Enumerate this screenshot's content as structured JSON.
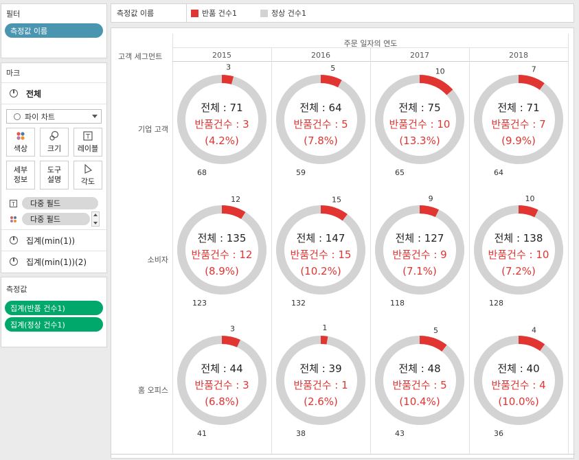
{
  "filters": {
    "title": "필터",
    "pill": "측정값 이름"
  },
  "marks": {
    "title": "마크",
    "all_label": "전체",
    "mark_type": "파이 차트",
    "buttons": [
      "색상",
      "크기",
      "레이블",
      "세부\n정보",
      "도구\n설명",
      "각도"
    ],
    "multi_field_label": "다중 필드",
    "multi_field_color": "다중 필드",
    "agg1": "집계(min(1))",
    "agg2": "집계(min(1))(2)"
  },
  "measures": {
    "title": "측정값",
    "pills": [
      "집계(반품 건수1)",
      "집계(정상 건수1)"
    ]
  },
  "legend": {
    "label": "측정값 이름",
    "items": [
      {
        "name": "반품 건수1",
        "color": "#e03531"
      },
      {
        "name": "정상 건수1",
        "color": "#d3d3d3"
      }
    ]
  },
  "viz": {
    "column_header_title": "주문 일자의 연도",
    "row_header_title": "고객 세그먼트",
    "years": [
      "2015",
      "2016",
      "2017",
      "2018"
    ],
    "segments": [
      "기업 고객",
      "소비자",
      "홈 오피스"
    ]
  },
  "chart_data": {
    "type": "pie",
    "series": [
      {
        "name": "반품 건수1",
        "color": "#e03531"
      },
      {
        "name": "정상 건수1",
        "color": "#d3d3d3"
      }
    ],
    "cells": [
      {
        "segment": "기업 고객",
        "year": "2015",
        "returned": 3,
        "normal": 68,
        "total": 71,
        "total_text": "전체 : 71",
        "returned_text": "반품건수 : 3",
        "pct_text": "(4.2%)"
      },
      {
        "segment": "기업 고객",
        "year": "2016",
        "returned": 5,
        "normal": 59,
        "total": 64,
        "total_text": "전체 : 64",
        "returned_text": "반품건수 : 5",
        "pct_text": "(7.8%)"
      },
      {
        "segment": "기업 고객",
        "year": "2017",
        "returned": 10,
        "normal": 65,
        "total": 75,
        "total_text": "전체 : 75",
        "returned_text": "반품건수 : 10",
        "pct_text": "(13.3%)"
      },
      {
        "segment": "기업 고객",
        "year": "2018",
        "returned": 7,
        "normal": 64,
        "total": 71,
        "total_text": "전체 : 71",
        "returned_text": "반품건수 : 7",
        "pct_text": "(9.9%)"
      },
      {
        "segment": "소비자",
        "year": "2015",
        "returned": 12,
        "normal": 123,
        "total": 135,
        "total_text": "전체 : 135",
        "returned_text": "반품건수 : 12",
        "pct_text": "(8.9%)"
      },
      {
        "segment": "소비자",
        "year": "2016",
        "returned": 15,
        "normal": 132,
        "total": 147,
        "total_text": "전체 : 147",
        "returned_text": "반품건수 : 15",
        "pct_text": "(10.2%)"
      },
      {
        "segment": "소비자",
        "year": "2017",
        "returned": 9,
        "normal": 118,
        "total": 127,
        "total_text": "전체 : 127",
        "returned_text": "반품건수 : 9",
        "pct_text": "(7.1%)"
      },
      {
        "segment": "소비자",
        "year": "2018",
        "returned": 10,
        "normal": 128,
        "total": 138,
        "total_text": "전체 : 138",
        "returned_text": "반품건수 : 10",
        "pct_text": "(7.2%)"
      },
      {
        "segment": "홈 오피스",
        "year": "2015",
        "returned": 3,
        "normal": 41,
        "total": 44,
        "total_text": "전체 : 44",
        "returned_text": "반품건수 : 3",
        "pct_text": "(6.8%)"
      },
      {
        "segment": "홈 오피스",
        "year": "2016",
        "returned": 1,
        "normal": 38,
        "total": 39,
        "total_text": "전체 : 39",
        "returned_text": "반품건수 : 1",
        "pct_text": "(2.6%)"
      },
      {
        "segment": "홈 오피스",
        "year": "2017",
        "returned": 5,
        "normal": 43,
        "total": 48,
        "total_text": "전체 : 48",
        "returned_text": "반품건수 : 5",
        "pct_text": "(10.4%)"
      },
      {
        "segment": "홈 오피스",
        "year": "2018",
        "returned": 4,
        "normal": 36,
        "total": 40,
        "total_text": "전체 : 40",
        "returned_text": "반품건수 : 4",
        "pct_text": "(10.0%)"
      }
    ]
  }
}
